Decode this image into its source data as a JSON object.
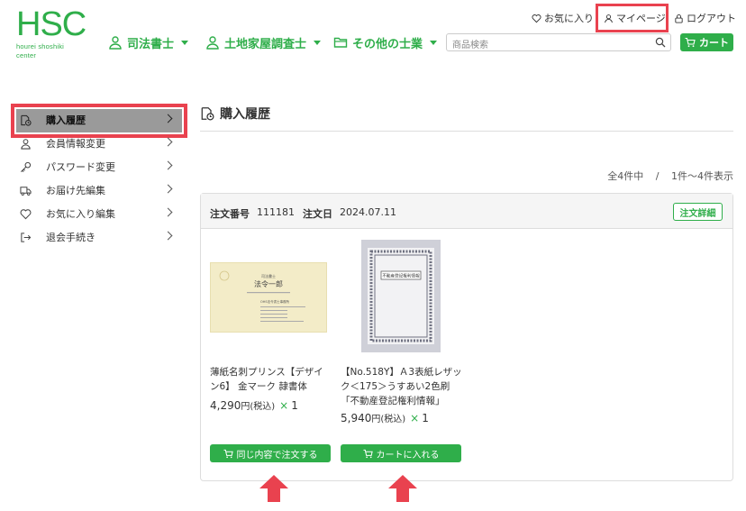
{
  "logo": {
    "main": "HSC",
    "sub": "hourei shoshiki center"
  },
  "utility": {
    "favorites": "お気に入り",
    "mypage": "マイページ",
    "logout": "ログアウト"
  },
  "nav": [
    {
      "label": "司法書士"
    },
    {
      "label": "土地家屋調査士"
    },
    {
      "label": "その他の士業"
    }
  ],
  "search": {
    "placeholder": "商品検索",
    "value": ""
  },
  "cart": {
    "label": "カート"
  },
  "sidebar": {
    "items": [
      {
        "label": "購入履歴",
        "icon": "purchase-history-icon",
        "active": true
      },
      {
        "label": "会員情報変更",
        "icon": "user-icon"
      },
      {
        "label": "パスワード変更",
        "icon": "key-icon"
      },
      {
        "label": "お届け先編集",
        "icon": "truck-icon"
      },
      {
        "label": "お気に入り編集",
        "icon": "heart-icon"
      },
      {
        "label": "退会手続き",
        "icon": "exit-icon"
      }
    ]
  },
  "main": {
    "title": "購入履歴",
    "pager": {
      "total": "全4件中",
      "sep": "/",
      "range": "1件～4件表示"
    },
    "order": {
      "number_label": "注文番号",
      "number": "111181",
      "date_label": "注文日",
      "date": "2024.07.11",
      "detail_button": "注文詳細",
      "items": [
        {
          "name": "薄紙名刺プリンス【デザイン6】 金マーク 隷書体",
          "price": "4,290",
          "unit": "円(税込)",
          "times": "×",
          "qty": "1",
          "button": "同じ内容で注文する",
          "image_text": {
            "role": "司法書士",
            "name": "法令一郎",
            "office": "OHS法令書士事務所"
          }
        },
        {
          "name": "【No.518Y】Ａ3表紙レザック＜175＞うすあい2色刷「不動産登記権利情報」",
          "price": "5,940",
          "unit": "円(税込)",
          "times": "×",
          "qty": "1",
          "button": "カートに入れる",
          "image_text": {
            "title": "不動産登記権利情報"
          }
        }
      ]
    }
  },
  "colors": {
    "brand": "#2fae4a",
    "highlight": "#e9424f",
    "active_bg": "#9a9a9a"
  }
}
